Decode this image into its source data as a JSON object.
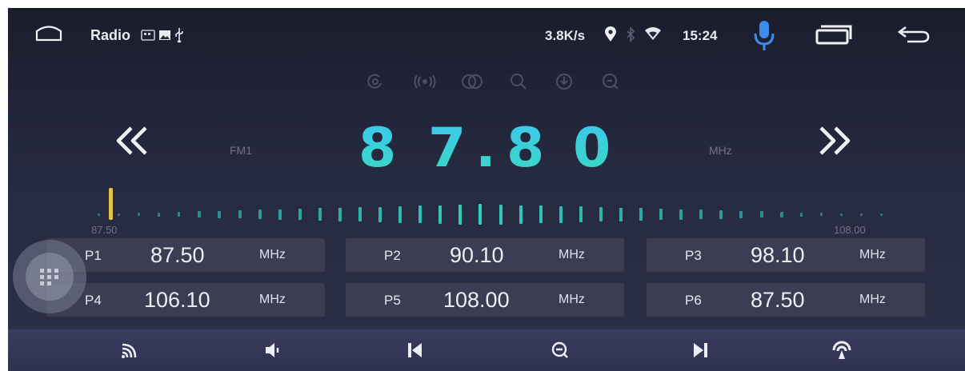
{
  "status_bar": {
    "app_label": "Radio",
    "net_speed": "3.8K/s",
    "time": "15:24"
  },
  "tuner": {
    "band": "FM1",
    "frequency_digits": [
      "8",
      "7",
      ".",
      "8",
      "0"
    ],
    "unit": "MHz",
    "scale_min": "87.50",
    "scale_max": "108.00",
    "needle_frequency": 87.8
  },
  "presets": [
    {
      "label": "P1",
      "freq": "87.50",
      "unit": "MHz"
    },
    {
      "label": "P2",
      "freq": "90.10",
      "unit": "MHz"
    },
    {
      "label": "P3",
      "freq": "98.10",
      "unit": "MHz"
    },
    {
      "label": "P4",
      "freq": "106.10",
      "unit": "MHz"
    },
    {
      "label": "P5",
      "freq": "108.00",
      "unit": "MHz"
    },
    {
      "label": "P6",
      "freq": "87.50",
      "unit": "MHz"
    }
  ],
  "colors": {
    "accent": "#3cc8f0",
    "mic": "#3c8cf0",
    "scale_tick": "#2fd0c0",
    "needle": "#e6c24a"
  },
  "icons": {
    "status": [
      "home-icon",
      "sd-card-icon",
      "image-icon",
      "usb-icon",
      "location-icon",
      "bluetooth-icon",
      "wifi-icon",
      "microphone-icon",
      "recent-apps-icon",
      "back-icon"
    ],
    "functions": [
      "rds-icon",
      "stereo-icon",
      "loc-dx-icon",
      "search-icon",
      "scan-icon",
      "zoom-icon"
    ],
    "bottom": [
      "signal-icon",
      "volume-icon",
      "previous-icon",
      "zoom-out-icon",
      "next-icon",
      "antenna-icon"
    ]
  }
}
